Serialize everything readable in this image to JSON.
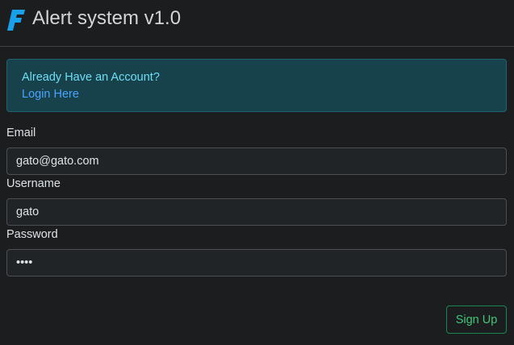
{
  "header": {
    "logo_icon": "f-logo-icon",
    "title": "Alert system v1.0"
  },
  "alert": {
    "message": "Already Have an Account?",
    "link_label": "Login Here"
  },
  "form": {
    "email_label": "Email",
    "email_value": "gato@gato.com",
    "username_label": "Username",
    "username_value": "gato",
    "password_label": "Password",
    "password_value": "gato",
    "submit_label": "Sign Up"
  },
  "colors": {
    "background": "#1c1d1f",
    "accent_logo": "#1aa0e8",
    "alert_bg": "#17414b",
    "alert_text": "#6edff6",
    "link": "#4aa3ff",
    "success": "#198754"
  }
}
